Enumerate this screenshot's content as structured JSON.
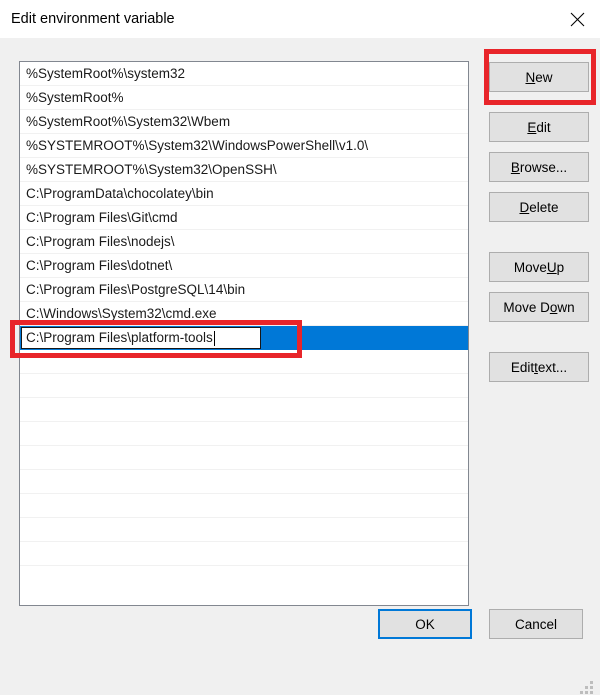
{
  "window": {
    "title": "Edit environment variable",
    "close_icon": "close-icon"
  },
  "path_list": {
    "entries": [
      "%SystemRoot%\\system32",
      "%SystemRoot%",
      "%SystemRoot%\\System32\\Wbem",
      "%SYSTEMROOT%\\System32\\WindowsPowerShell\\v1.0\\",
      "%SYSTEMROOT%\\System32\\OpenSSH\\",
      "C:\\ProgramData\\chocolatey\\bin",
      "C:\\Program Files\\Git\\cmd",
      "C:\\Program Files\\nodejs\\",
      "C:\\Program Files\\dotnet\\",
      "C:\\Program Files\\PostgreSQL\\14\\bin",
      "C:\\Windows\\System32\\cmd.exe"
    ],
    "editing_value": "C:\\Program Files\\platform-tools",
    "selection_color": "#0078d7",
    "empty_row_count": 9
  },
  "side_buttons": {
    "new": {
      "pre": "",
      "accel": "N",
      "post": "ew"
    },
    "edit": {
      "pre": "",
      "accel": "E",
      "post": "dit"
    },
    "browse": {
      "pre": "",
      "accel": "B",
      "post": "rowse..."
    },
    "delete": {
      "pre": "",
      "accel": "D",
      "post": "elete"
    },
    "move_up": {
      "pre": "Move ",
      "accel": "U",
      "post": "p"
    },
    "move_down": {
      "pre": "Move D",
      "accel": "o",
      "post": "wn"
    },
    "edit_text": {
      "pre": "Edit ",
      "accel": "t",
      "post": "ext..."
    }
  },
  "bottom_buttons": {
    "ok": "OK",
    "cancel": "Cancel"
  },
  "annotations": {
    "color": "#e8252a",
    "targets": [
      "new-button",
      "inline-edit-field"
    ]
  }
}
